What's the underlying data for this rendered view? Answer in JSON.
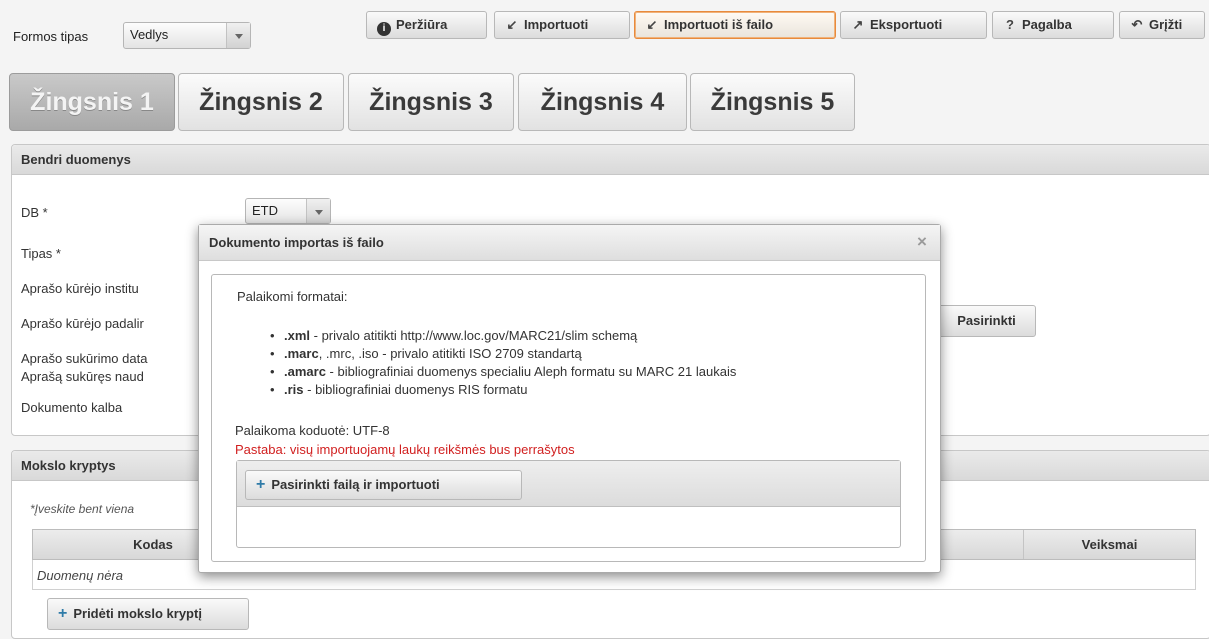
{
  "toolbar": {
    "form_type_label": "Formos tipas",
    "form_type_value": "Vedlys",
    "buttons": [
      {
        "label": "Peržiūra"
      },
      {
        "label": "Importuoti"
      },
      {
        "label": "Importuoti iš failo"
      },
      {
        "label": "Eksportuoti"
      },
      {
        "label": "Pagalba"
      },
      {
        "label": "Grįžti"
      }
    ]
  },
  "steps": [
    "Žingsnis 1",
    "Žingsnis 2",
    "Žingsnis 3",
    "Žingsnis 4",
    "Žingsnis 5"
  ],
  "general": {
    "title": "Bendri duomenys",
    "db_label": "DB *",
    "db_value": "ETD",
    "type_label": "Tipas *",
    "creator_institution_label": "Aprašo kūrėjo institu",
    "creator_unit_label": "Aprašo kūrėjo padalir",
    "creation_date_label": "Aprašo sukūrimo data",
    "creator_user_label": "Aprašą sukūręs naud",
    "language_label": "Dokumento kalba",
    "choose_button": "Pasirinkti"
  },
  "science": {
    "title": "Mokslo kryptys",
    "hint": "*Įveskite bent viena",
    "col_code": "Kodas",
    "col_actions": "Veiksmai",
    "empty": "Duomenų nėra",
    "add_button": "Pridėti mokslo kryptį"
  },
  "dialog": {
    "title": "Dokumento importas iš failo",
    "close": "×",
    "supported_formats_label": "Palaikomi formatai:",
    "formats": [
      {
        "ext": ".xml",
        "desc": " - privalo atitikti http://www.loc.gov/MARC21/slim schemą"
      },
      {
        "ext": ".marc",
        "desc": ", .mrc, .iso - privalo atitikti ISO 2709 standartą"
      },
      {
        "ext": ".amarc",
        "desc": " - bibliografiniai duomenys specialiu Aleph formatu su MARC 21 laukais"
      },
      {
        "ext": ".ris",
        "desc": " - bibliografiniai duomenys RIS formatu"
      }
    ],
    "encoding": "Palaikoma koduotė: UTF-8",
    "warning": "Pastaba: visų importuojamų laukų reikšmės bus perrašytos",
    "upload_button": "Pasirinkti failą ir importuoti"
  },
  "colors": {
    "accent_border": "#e88a3c",
    "warning_text": "#d11f1f",
    "plus_icon": "#2f7ba8"
  }
}
